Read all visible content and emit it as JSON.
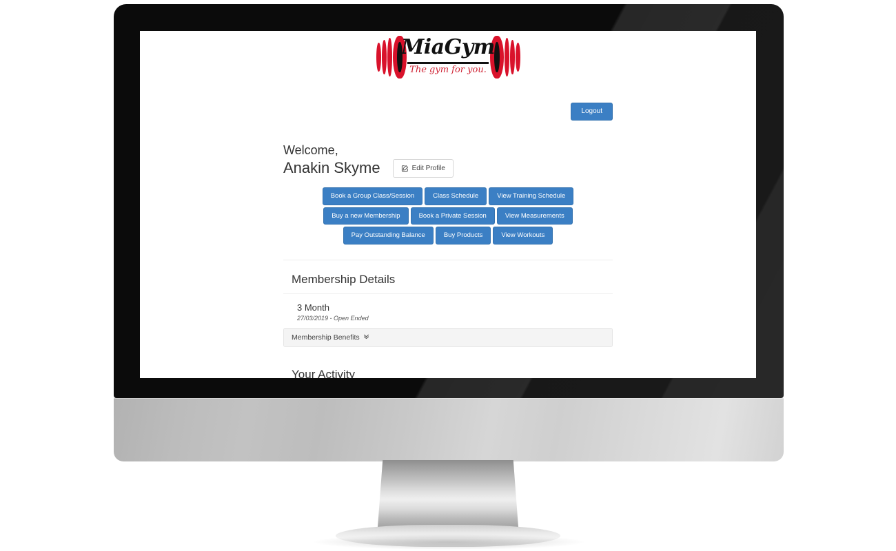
{
  "brand": {
    "name": "MiaGym",
    "tagline": "The gym for you.",
    "logo_red": "#d9122b",
    "logo_black": "#111111"
  },
  "theme": {
    "primary_blue": "#3b7fc4",
    "bezel_black": "#0b0b0b",
    "chin_silver": "#cfcfcf",
    "page_background": "#ffffff"
  },
  "header": {
    "logout_label": "Logout"
  },
  "welcome": {
    "greeting": "Welcome,",
    "user_name": "Anakin Skyme",
    "edit_profile_label": "Edit Profile",
    "edit_profile_icon": "edit-pencil-square-icon"
  },
  "actions": {
    "row1": [
      {
        "label": "Book a Group Class/Session",
        "name": "book-group-class-button"
      },
      {
        "label": "Class Schedule",
        "name": "class-schedule-button"
      },
      {
        "label": "View Training Schedule",
        "name": "view-training-schedule-button"
      }
    ],
    "row2": [
      {
        "label": "Buy a new Membership",
        "name": "buy-new-membership-button"
      },
      {
        "label": "Book a Private Session",
        "name": "book-private-session-button"
      },
      {
        "label": "View Measurements",
        "name": "view-measurements-button"
      }
    ],
    "row3": [
      {
        "label": "Pay Outstanding Balance",
        "name": "pay-outstanding-balance-button"
      },
      {
        "label": "Buy Products",
        "name": "buy-products-button"
      },
      {
        "label": "View Workouts",
        "name": "view-workouts-button"
      }
    ]
  },
  "membership": {
    "section_title": "Membership Details",
    "plan_name": "3 Month",
    "plan_dates": "27/03/2019 - Open Ended",
    "benefits_label": "Membership Benefits",
    "benefits_chevron": "»"
  },
  "activity": {
    "section_title": "Your Activity"
  }
}
